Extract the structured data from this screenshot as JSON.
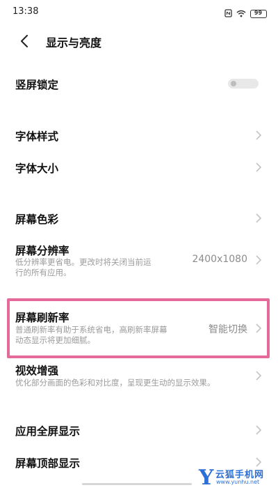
{
  "status_bar": {
    "time": "13:38",
    "battery": "99"
  },
  "header": {
    "title": "显示与亮度"
  },
  "settings": {
    "portrait_lock": {
      "label": "竖屏锁定",
      "enabled": false
    },
    "font_style": {
      "label": "字体样式"
    },
    "font_size": {
      "label": "字体大小"
    },
    "screen_color": {
      "label": "屏幕色彩"
    },
    "resolution": {
      "label": "屏幕分辨率",
      "description_line1": "低分辨率更省电。更改时将关闭当前运",
      "description_line2": "行的所有应用。",
      "value": "2400x1080"
    },
    "refresh_rate": {
      "label": "屏幕刷新率",
      "description_line1": "普通刷新率有助于系统省电，高刷新率屏幕",
      "description_line2": "动态显示将更加细腻。",
      "value": "智能切换"
    },
    "visual_enhance": {
      "label": "视效增强",
      "description": "优化部分画面的色彩和对比度，呈现更生动的显示效果。"
    },
    "app_fullscreen": {
      "label": "应用全屏显示"
    },
    "top_display": {
      "label": "屏幕顶部显示"
    }
  },
  "colors": {
    "highlight": "#e46a9a",
    "watermark": "#2c6fd6"
  },
  "watermark": {
    "letter": "Y",
    "name": "云狐手机网",
    "url": "www.yunhu.net"
  }
}
